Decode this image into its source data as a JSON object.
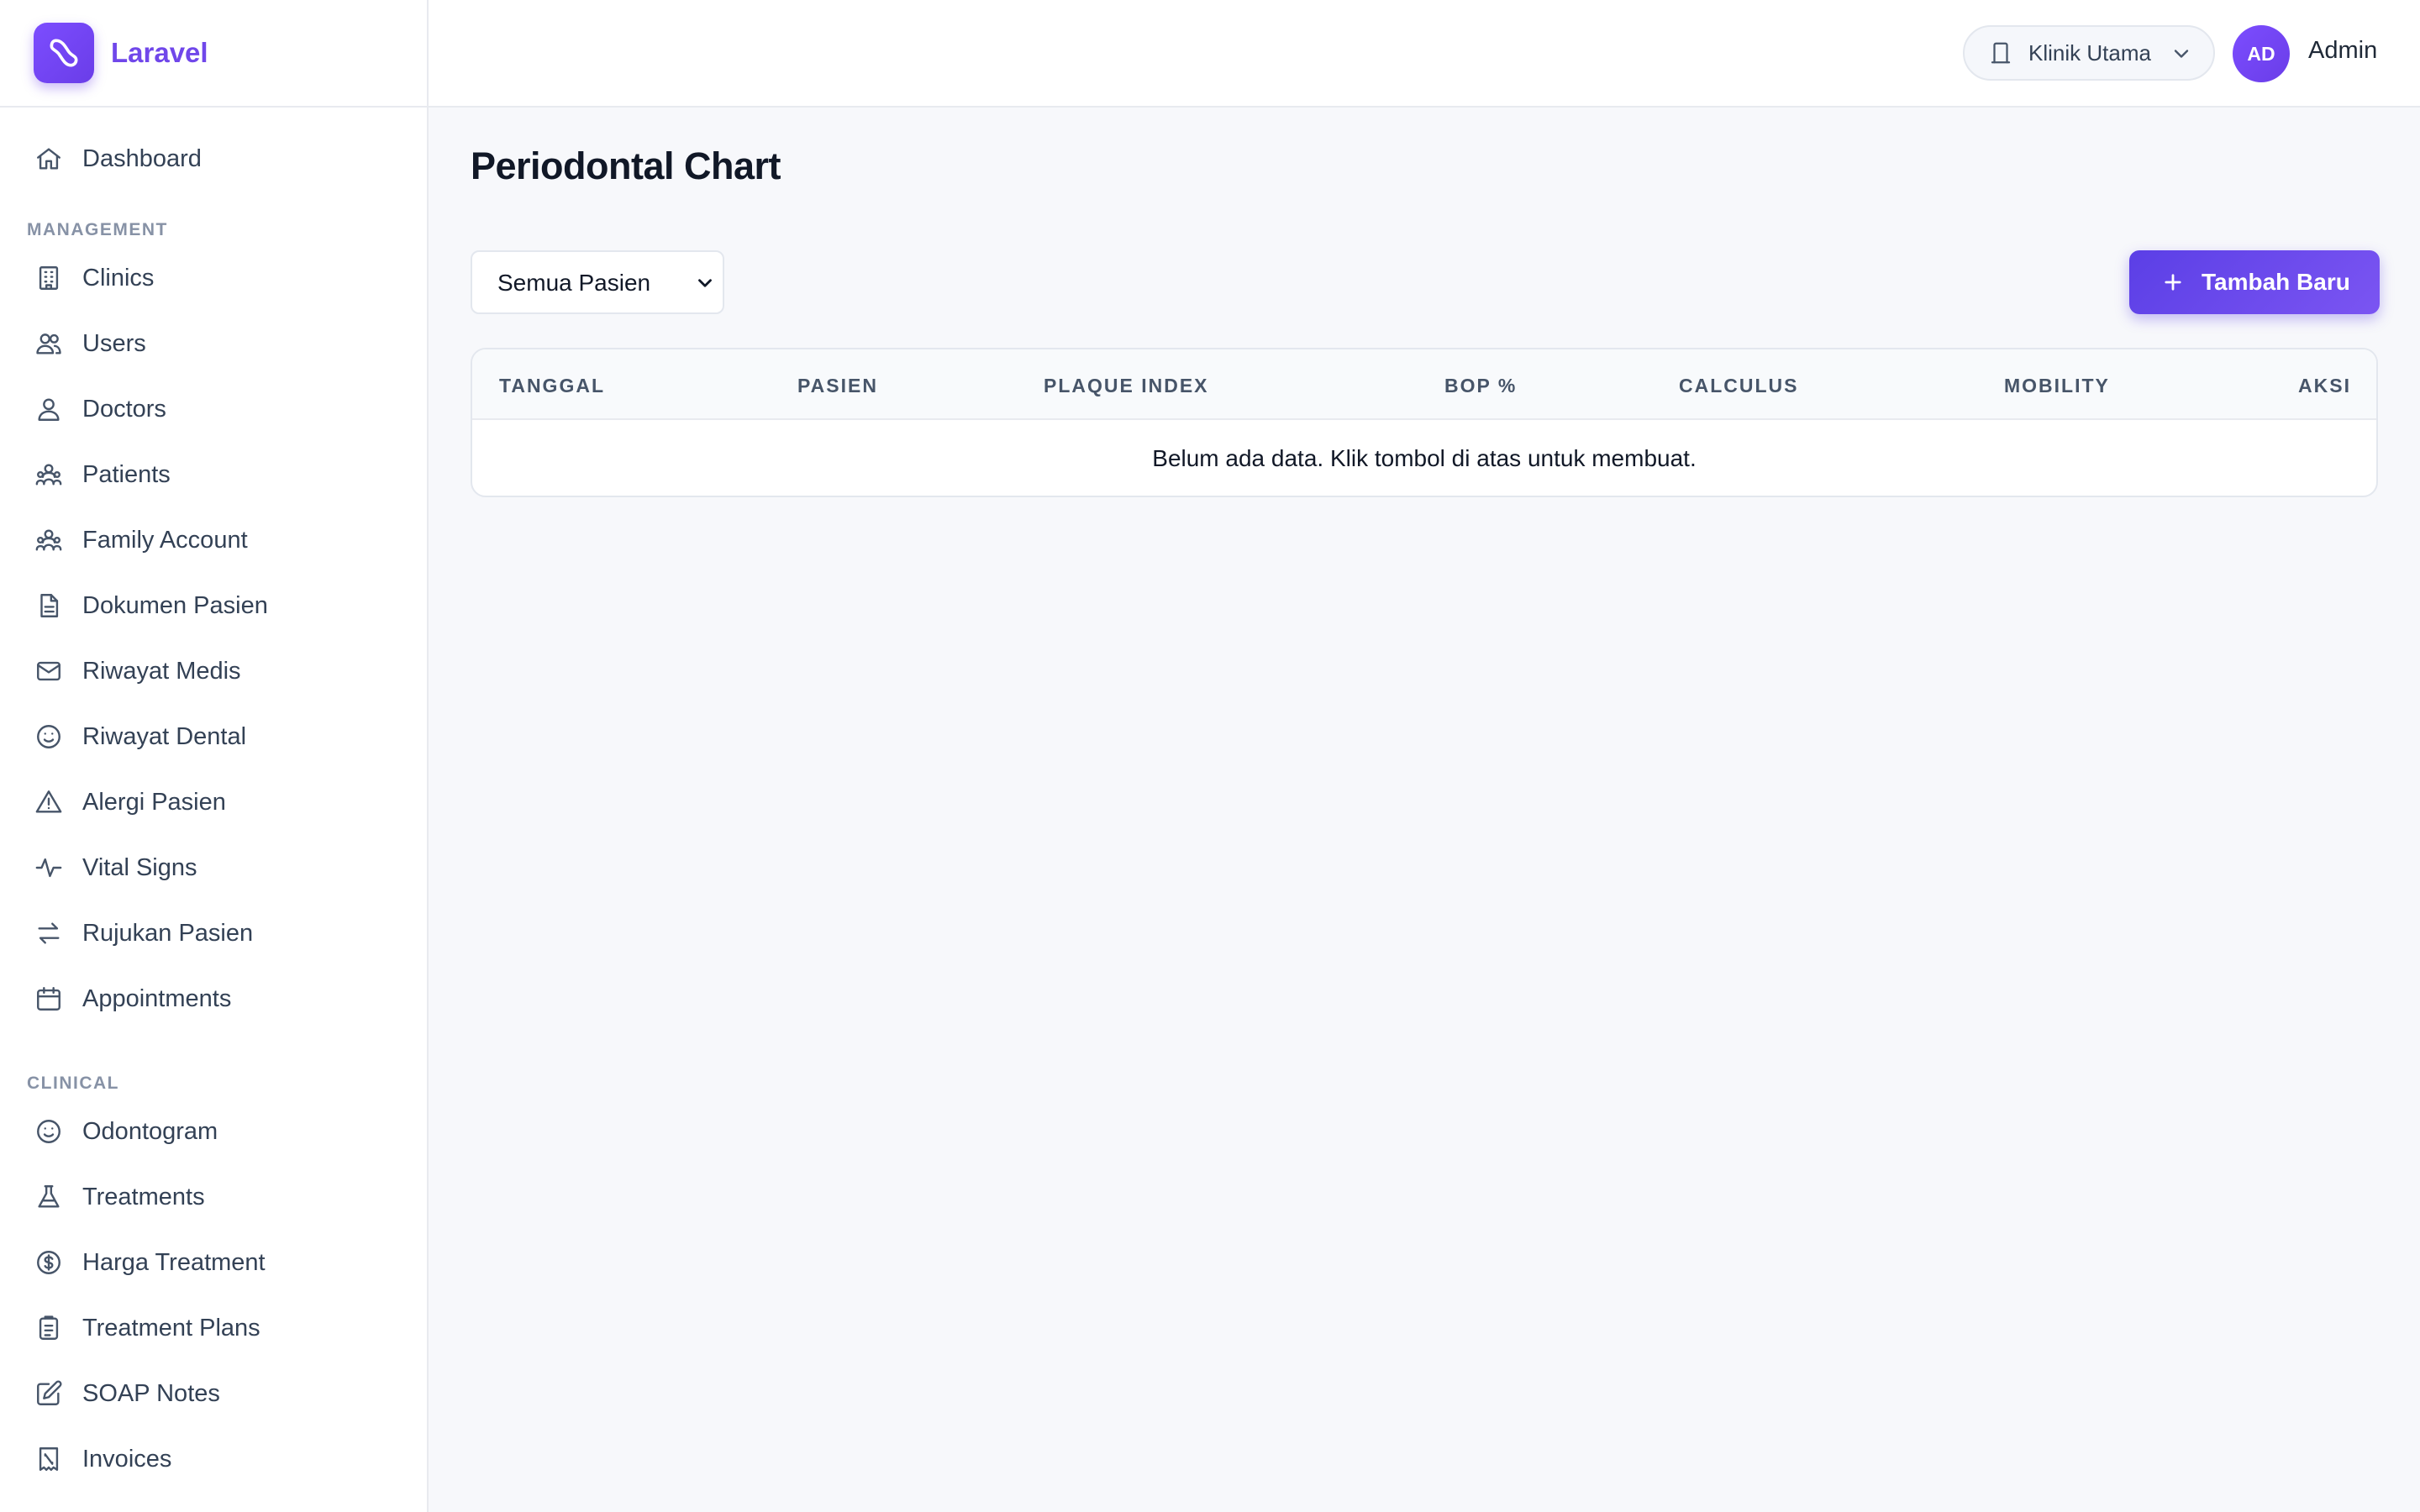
{
  "brand": {
    "name": "Laravel"
  },
  "sidebar": {
    "top_items": [
      {
        "label": "Dashboard",
        "icon": "home-icon"
      }
    ],
    "sections": [
      {
        "title": "MANAGEMENT",
        "items": [
          {
            "label": "Clinics",
            "icon": "building-icon"
          },
          {
            "label": "Users",
            "icon": "users-icon"
          },
          {
            "label": "Doctors",
            "icon": "user-icon"
          },
          {
            "label": "Patients",
            "icon": "user-group-icon"
          },
          {
            "label": "Family Account",
            "icon": "user-group-icon"
          },
          {
            "label": "Dokumen Pasien",
            "icon": "document-icon"
          },
          {
            "label": "Riwayat Medis",
            "icon": "envelope-icon"
          },
          {
            "label": "Riwayat Dental",
            "icon": "smiley-icon"
          },
          {
            "label": "Alergi Pasien",
            "icon": "warning-icon"
          },
          {
            "label": "Vital Signs",
            "icon": "pulse-icon"
          },
          {
            "label": "Rujukan Pasien",
            "icon": "arrows-exchange-icon"
          },
          {
            "label": "Appointments",
            "icon": "calendar-icon"
          }
        ]
      },
      {
        "title": "CLINICAL",
        "items": [
          {
            "label": "Odontogram",
            "icon": "smiley-icon"
          },
          {
            "label": "Treatments",
            "icon": "beaker-icon"
          },
          {
            "label": "Harga Treatment",
            "icon": "dollar-circle-icon"
          },
          {
            "label": "Treatment Plans",
            "icon": "clipboard-icon"
          },
          {
            "label": "SOAP Notes",
            "icon": "pencil-square-icon"
          },
          {
            "label": "Invoices",
            "icon": "receipt-icon"
          }
        ]
      }
    ]
  },
  "topbar": {
    "clinic_selector": "Klinik Utama",
    "avatar_initials": "AD",
    "user_name": "Admin"
  },
  "main": {
    "title": "Periodontal Chart",
    "filter": {
      "selected": "Semua Pasien",
      "options": [
        "Semua Pasien"
      ]
    },
    "add_button_label": "Tambah Baru",
    "table": {
      "columns": [
        "TANGGAL",
        "PASIEN",
        "PLAQUE INDEX",
        "BOP %",
        "CALCULUS",
        "MOBILITY",
        "AKSI"
      ],
      "empty_message": "Belum ada data. Klik tombol di atas untuk membuat."
    }
  },
  "colors": {
    "accent": "#7047ea",
    "button_start": "#5b3fe6",
    "button_end": "#7b55f2",
    "background": "#f7f8fb"
  }
}
